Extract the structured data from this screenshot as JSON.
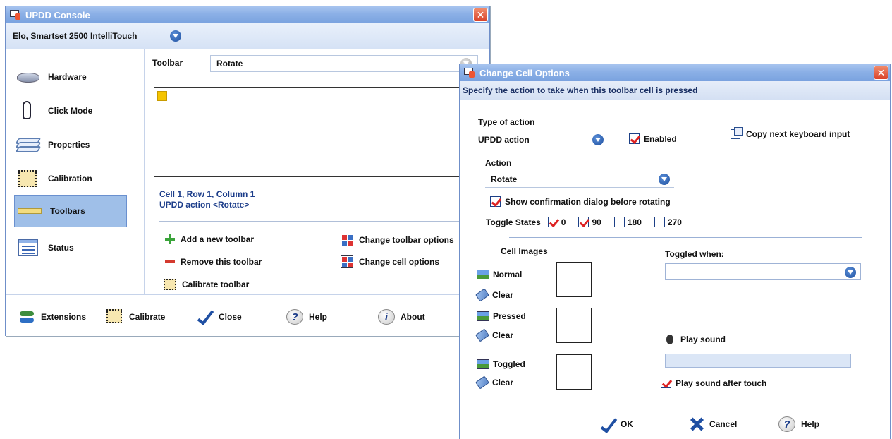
{
  "console": {
    "title": "UPDD Console",
    "close_glyph": "✕",
    "device": "Elo, Smartset 2500 IntelliTouch",
    "sidebar": [
      {
        "label": "Hardware",
        "icon": "hardware-icon"
      },
      {
        "label": "Click Mode",
        "icon": "hand-pointer-icon"
      },
      {
        "label": "Properties",
        "icon": "layers-icon"
      },
      {
        "label": "Calibration",
        "icon": "calibration-icon"
      },
      {
        "label": "Toolbars",
        "icon": "ruler-icon",
        "selected": true
      },
      {
        "label": "Status",
        "icon": "status-icon"
      }
    ],
    "toolbar_label": "Toolbar",
    "toolbar_value": "Rotate",
    "cell_info_line1": "Cell 1, Row 1, Column 1",
    "cell_info_line2": "UPDD action <Rotate>",
    "actions": {
      "add": "Add a new toolbar",
      "remove": "Remove this toolbar",
      "calibrate": "Calibrate toolbar",
      "change_toolbar": "Change toolbar options",
      "change_cell": "Change cell options"
    },
    "footer": {
      "extensions": "Extensions",
      "calibrate": "Calibrate",
      "close": "Close",
      "help": "Help",
      "about": "About",
      "help_glyph": "?",
      "about_glyph": "i"
    }
  },
  "dialog": {
    "title": "Change Cell Options",
    "close_glyph": "✕",
    "subtitle": "Specify the action to take when this toolbar cell is pressed",
    "type_label": "Type of action",
    "type_value": "UPDD action",
    "enabled_label": "Enabled",
    "enabled": true,
    "copy_label": "Copy next keyboard input",
    "action_label": "Action",
    "action_value": "Rotate",
    "confirm_label": "Show confirmation dialog before rotating",
    "confirm_checked": true,
    "toggle_label": "Toggle States",
    "toggle_states": [
      {
        "label": "0",
        "checked": true
      },
      {
        "label": "90",
        "checked": true
      },
      {
        "label": "180",
        "checked": false
      },
      {
        "label": "270",
        "checked": false
      }
    ],
    "cell_images_label": "Cell Images",
    "toggled_when_label": "Toggled when:",
    "toggled_when_value": "",
    "normal_label": "Normal",
    "pressed_label": "Pressed",
    "toggled_label": "Toggled",
    "clear_label": "Clear",
    "play_sound_label": "Play sound",
    "play_sound_value": "",
    "play_after_label": "Play sound after touch",
    "play_after_checked": true,
    "buttons": {
      "ok": "OK",
      "cancel": "Cancel",
      "help": "Help",
      "help_glyph": "?"
    }
  },
  "colors": {
    "titlebar": "#8bb0e6",
    "selection": "#9fbfe8",
    "accent_blue": "#1f4fa3",
    "check_red": "#d22222"
  }
}
